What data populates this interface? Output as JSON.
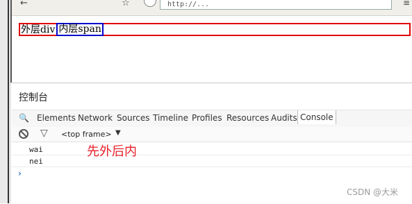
{
  "browser": {
    "back_glyph": "←",
    "history_glyph": "☆",
    "address_text": "http://...",
    "right_glyph": "≡"
  },
  "page": {
    "outer_label": "外层div",
    "inner_label": "内层span"
  },
  "devtools": {
    "title": "控制台",
    "tabs": [
      "Elements",
      "Network",
      "Sources",
      "Timeline",
      "Profiles",
      "Resources",
      "Audits",
      "Console"
    ],
    "active_tab": "Console",
    "frame_select": "<top frame>",
    "log": [
      "wai",
      "nei"
    ],
    "prompt": "›"
  },
  "annotation": "先外后内",
  "watermark": "CSDN @大米"
}
